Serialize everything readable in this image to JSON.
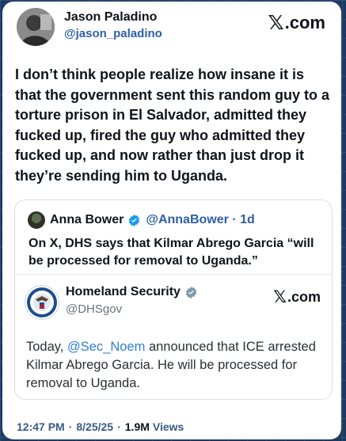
{
  "post": {
    "author_name": "Jason Paladino",
    "author_handle": "@jason_paladino",
    "brand_x": "𝕏",
    "brand_suffix": ".com",
    "text": "I don’t think people realize how insane it is that the government sent this random guy to a torture prison in El Salvador, admitted they fucked up, fired the guy who admitted they fucked up, and now rather than just drop it they’re sending him to Uganda.",
    "time": "12:47 PM",
    "separator": "·",
    "date": "8/25/25",
    "views_count": "1.9M",
    "views_label": "Views"
  },
  "quote": {
    "author_name": "Anna Bower",
    "author_handle": "@AnnaBower",
    "separator": "·",
    "age": "1d",
    "text": "On X, DHS says that Kilmar Abrego Garcia “will be processed for removal to Uganda.”",
    "verified_icon": "verified-badge-icon"
  },
  "embedded": {
    "author_name": "Homeland Security",
    "author_handle": "@DHSgov",
    "brand_x": "𝕏",
    "brand_suffix": ".com",
    "text_before": "Today, ",
    "mention": "@Sec_Noem",
    "text_after": " announced that ICE arrested Kilmar Abrego Garcia. He will be processed for removal to Uganda.",
    "verified_icon": "verified-badge-gray-icon",
    "seal_icon": "dhs-seal-icon"
  },
  "colors": {
    "background": "#1d3960",
    "handle": "#2d5fa8",
    "mention": "#2e7fd6",
    "verified_blue": "#1d9bf0",
    "verified_gray": "#829aab"
  }
}
